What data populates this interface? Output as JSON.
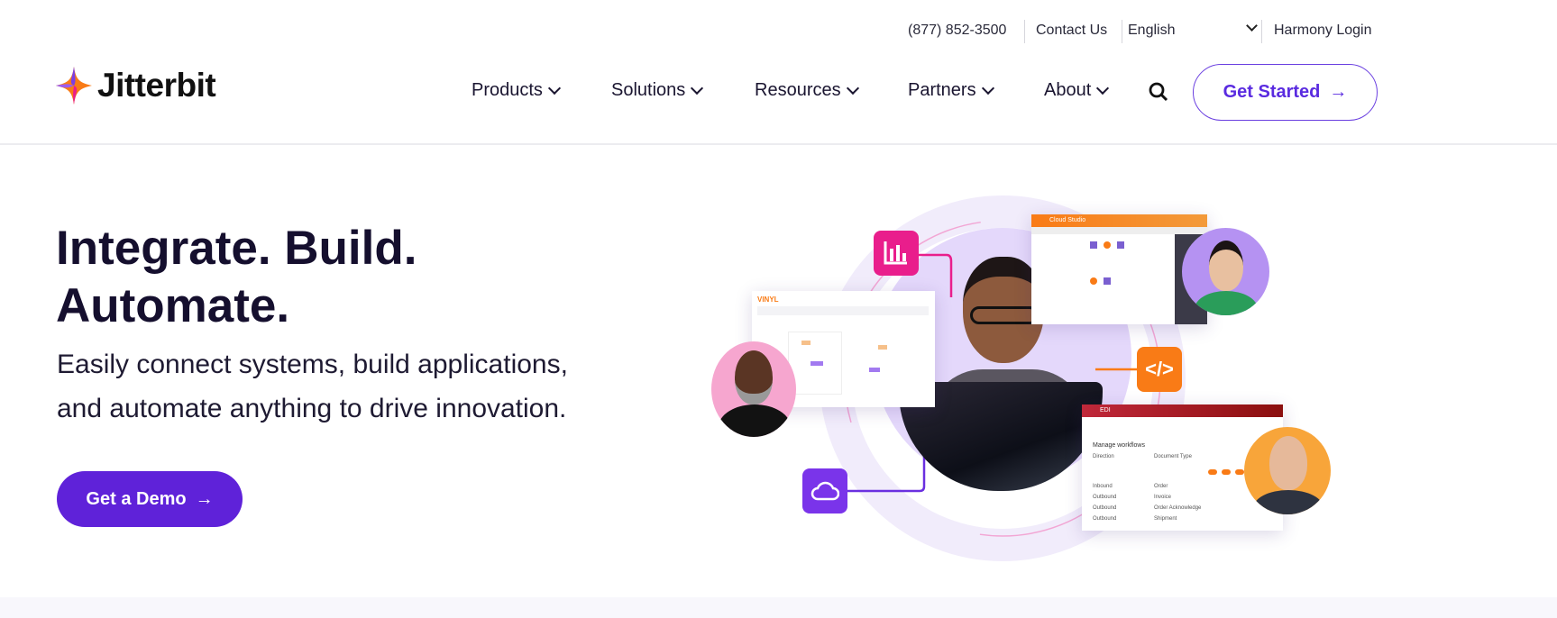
{
  "topbar": {
    "phone": "(877) 852-3500",
    "contact": "Contact Us",
    "language": "English",
    "login": "Harmony Login"
  },
  "brand": {
    "name": "Jitterbit",
    "colors": {
      "purple": "#5f22d9",
      "pink": "#e91e8c",
      "orange": "#f97b16"
    }
  },
  "nav": {
    "items": [
      {
        "label": "Products"
      },
      {
        "label": "Solutions"
      },
      {
        "label": "Resources"
      },
      {
        "label": "Partners"
      },
      {
        "label": "About"
      }
    ],
    "search_icon": "search-icon",
    "cta": "Get Started"
  },
  "hero": {
    "title_line1": "Integrate. Build.",
    "title_line2": "Automate.",
    "subtitle_line1": "Easily connect systems, build applications,",
    "subtitle_line2": "and automate anything to drive innovation.",
    "cta": "Get a Demo"
  },
  "illustration": {
    "vinyl_title": "VINYL",
    "cloud_studio_title": "Cloud Studio",
    "edi_title": "EDI",
    "edi_heading": "Manage workflows",
    "edi_col1": "Direction",
    "edi_col2": "Document Type",
    "edi_rows": [
      {
        "dir": "Inbound",
        "doc": "Order"
      },
      {
        "dir": "Outbound",
        "doc": "Invoice"
      },
      {
        "dir": "Outbound",
        "doc": "Order Acknowledge"
      },
      {
        "dir": "Outbound",
        "doc": "Shipment"
      }
    ]
  }
}
